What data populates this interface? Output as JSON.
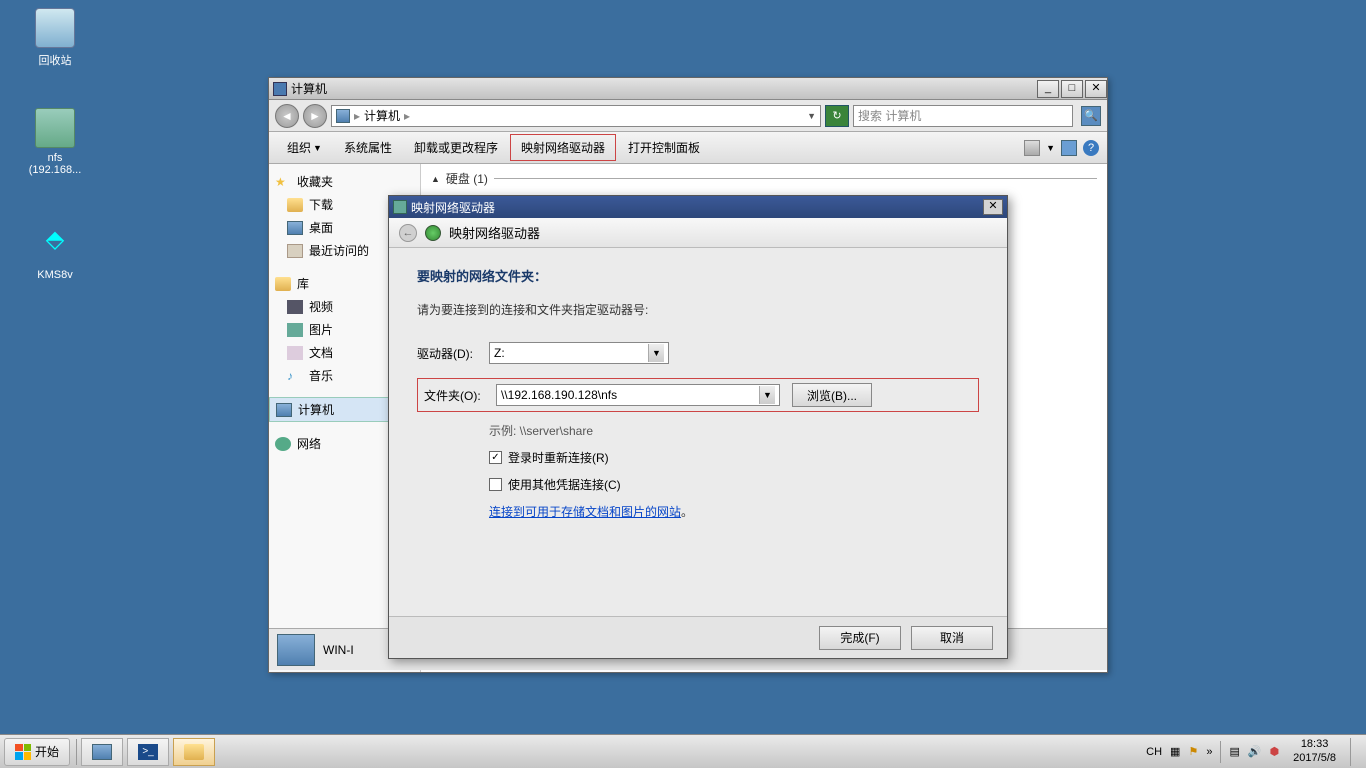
{
  "desktop": {
    "recycle_label": "回收站",
    "nfs_label": "nfs",
    "nfs_sub": "(192.168...",
    "kms_label": "KMS8v"
  },
  "explorer": {
    "title": "计算机",
    "addr": "计算机",
    "search_placeholder": "搜索 计算机",
    "toolbar": {
      "organize": "组织",
      "sysprops": "系统属性",
      "uninstall": "卸载或更改程序",
      "mapdrive": "映射网络驱动器",
      "controlpanel": "打开控制面板"
    },
    "sidebar": {
      "favorites": "收藏夹",
      "downloads": "下载",
      "desktop": "桌面",
      "recent": "最近访问的",
      "libraries": "库",
      "videos": "视频",
      "pictures": "图片",
      "documents": "文档",
      "music": "音乐",
      "computer": "计算机",
      "network": "网络"
    },
    "section_hdd": "硬盘 (1)",
    "status_name": "WIN-I"
  },
  "dialog": {
    "titlebar": "映射网络驱动器",
    "subtitle": "映射网络驱动器",
    "heading": "要映射的网络文件夹：",
    "instruction": "请为要连接到的连接和文件夹指定驱动器号:",
    "drive_label": "驱动器(D):",
    "drive_value": "Z:",
    "folder_label": "文件夹(O):",
    "folder_value": "\\\\192.168.190.128\\nfs",
    "browse": "浏览(B)...",
    "example": "示例: \\\\server\\share",
    "reconnect": "登录时重新连接(R)",
    "othercred": "使用其他凭据连接(C)",
    "link": "连接到可用于存储文档和图片的网站",
    "finish": "完成(F)",
    "cancel": "取消"
  },
  "taskbar": {
    "start": "开始",
    "lang": "CH",
    "time": "18:33",
    "date": "2017/5/8"
  }
}
